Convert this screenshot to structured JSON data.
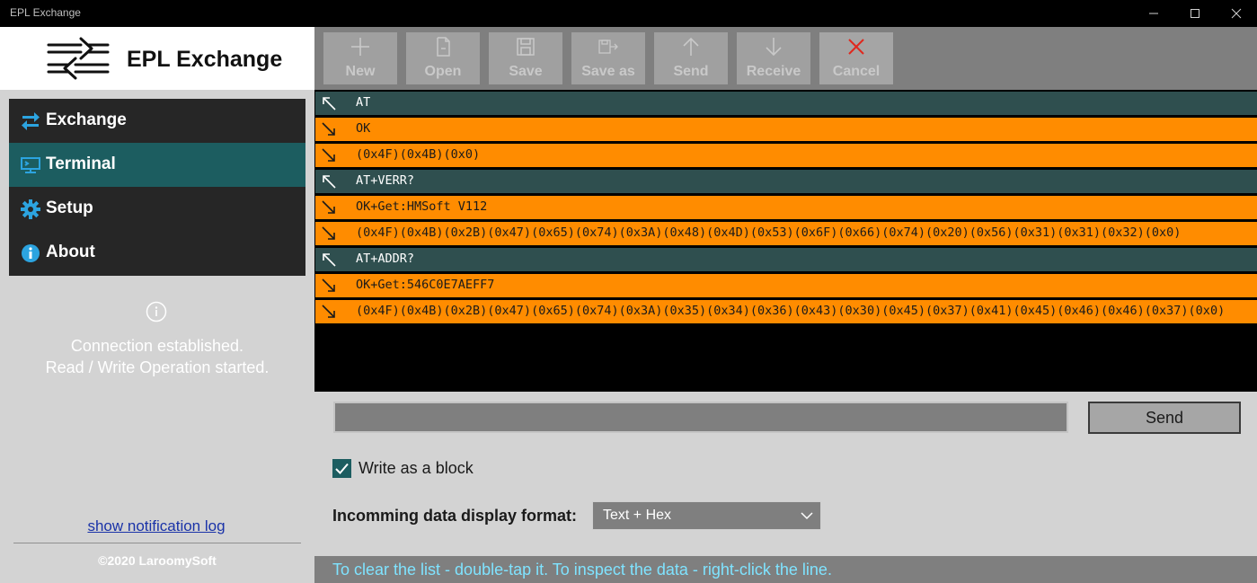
{
  "window": {
    "title": "EPL Exchange",
    "controls": [
      "minimize",
      "maximize",
      "close"
    ]
  },
  "sidebar": {
    "app_name": "EPL Exchange",
    "nav": [
      {
        "label": "Exchange",
        "icon": "exchange-arrows-icon",
        "active": false
      },
      {
        "label": "Terminal",
        "icon": "terminal-icon",
        "active": true
      },
      {
        "label": "Setup",
        "icon": "gear-icon",
        "active": false
      },
      {
        "label": "About",
        "icon": "info-icon",
        "active": false
      }
    ],
    "status_line1": "Connection established.",
    "status_line2": "Read / Write Operation started.",
    "notification_link": "show notification log",
    "copyright": "2020 LaroomySoft"
  },
  "toolbar": {
    "items": [
      {
        "label": "New",
        "icon": "plus-icon"
      },
      {
        "label": "Open",
        "icon": "open-file-icon"
      },
      {
        "label": "Save",
        "icon": "save-icon"
      },
      {
        "label": "Save as",
        "icon": "save-as-icon"
      },
      {
        "label": "Send",
        "icon": "arrow-up-icon"
      },
      {
        "label": "Receive",
        "icon": "arrow-down-icon"
      },
      {
        "label": "Cancel",
        "icon": "cancel-x-icon"
      }
    ]
  },
  "terminal": {
    "rows": [
      {
        "dir": "out",
        "text": "AT"
      },
      {
        "dir": "in",
        "text": "OK"
      },
      {
        "dir": "in",
        "text": "(0x4F)(0x4B)(0x0)"
      },
      {
        "dir": "out",
        "text": "AT+VERR?"
      },
      {
        "dir": "in",
        "text": "OK+Get:HMSoft V112"
      },
      {
        "dir": "in",
        "text": "(0x4F)(0x4B)(0x2B)(0x47)(0x65)(0x74)(0x3A)(0x48)(0x4D)(0x53)(0x6F)(0x66)(0x74)(0x20)(0x56)(0x31)(0x31)(0x32)(0x0)"
      },
      {
        "dir": "out",
        "text": "AT+ADDR?"
      },
      {
        "dir": "in",
        "text": "OK+Get:546C0E7AEFF7"
      },
      {
        "dir": "in",
        "text": "(0x4F)(0x4B)(0x2B)(0x47)(0x65)(0x74)(0x3A)(0x35)(0x34)(0x36)(0x43)(0x30)(0x45)(0x37)(0x41)(0x45)(0x46)(0x46)(0x37)(0x0)"
      }
    ]
  },
  "controls": {
    "input_value": "",
    "send_label": "Send",
    "write_block_label": "Write as a block",
    "write_block_checked": true,
    "format_label": "Incomming data display format:",
    "format_value": "Text + Hex",
    "hint": "To clear the list - double-tap it. To inspect the data - right-click the line."
  },
  "colors": {
    "accent": "#1c5d60",
    "outgoing_row": "#2f4f4f",
    "incoming_row": "#ff8c00",
    "hint_text": "#7fe3ff"
  }
}
